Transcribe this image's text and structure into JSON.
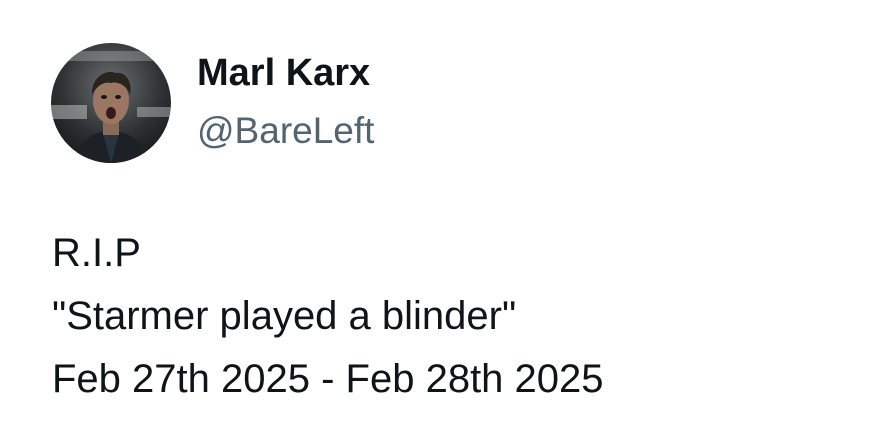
{
  "author": {
    "display_name": "Marl Karx",
    "handle": "@BareLeft",
    "avatar_icon": "profile-avatar"
  },
  "tweet": {
    "lines": [
      "R.I.P",
      "\"Starmer played a blinder\"",
      "Feb 27th 2025 - Feb 28th 2025"
    ]
  },
  "colors": {
    "text_primary": "#0f1419",
    "text_secondary": "#536471",
    "background": "#ffffff"
  }
}
